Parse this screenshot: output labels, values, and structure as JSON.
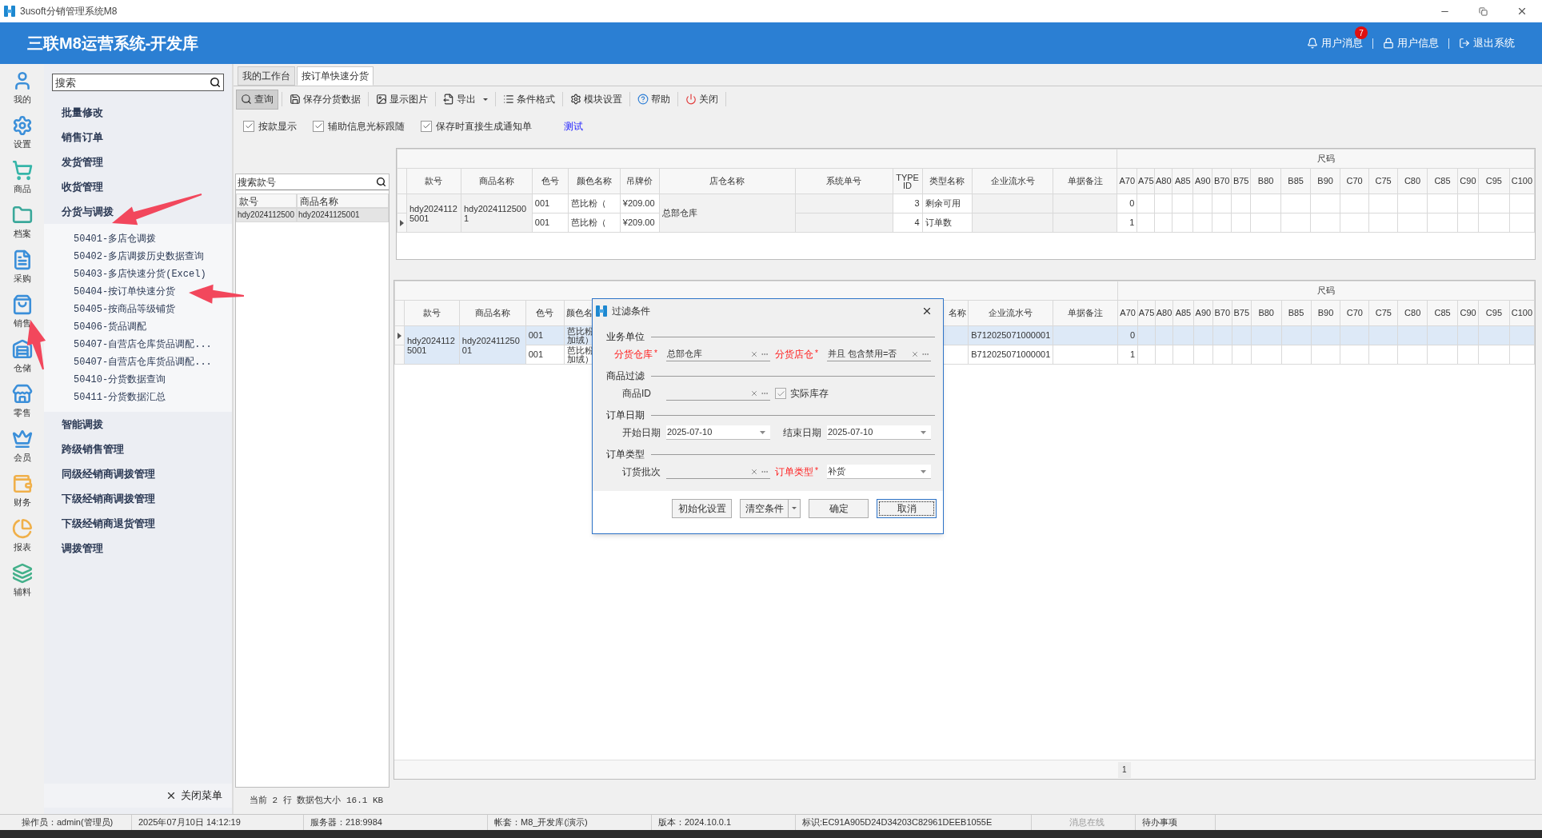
{
  "window": {
    "title": "3usoft分销管理系统M8"
  },
  "header": {
    "title": "三联M8运营系统-开发库",
    "actions": [
      {
        "kind": "messages",
        "label": "用户消息",
        "badge": "7"
      },
      {
        "kind": "user",
        "label": "用户信息"
      },
      {
        "kind": "logout",
        "label": "退出系统"
      }
    ]
  },
  "rail": [
    {
      "kind": "user",
      "label": "我的"
    },
    {
      "kind": "settings",
      "label": "设置"
    },
    {
      "kind": "cart",
      "label": "商品"
    },
    {
      "kind": "folder",
      "label": "档案"
    },
    {
      "kind": "doc",
      "label": "采购"
    },
    {
      "kind": "bag",
      "label": "销售"
    },
    {
      "kind": "warehouse",
      "label": "仓储"
    },
    {
      "kind": "store",
      "label": "零售"
    },
    {
      "kind": "crown",
      "label": "会员"
    },
    {
      "kind": "wallet",
      "label": "财务"
    },
    {
      "kind": "pie",
      "label": "报表"
    },
    {
      "kind": "layers",
      "label": "辅料"
    }
  ],
  "menu": {
    "search_placeholder": "搜索",
    "close_label": "关闭菜单",
    "groups": [
      {
        "label": "批量修改"
      },
      {
        "label": "销售订单"
      },
      {
        "label": "发货管理"
      },
      {
        "label": "收货管理"
      },
      {
        "label": "分货与调拨",
        "children": [
          {
            "label": "50401-多店仓调拨"
          },
          {
            "label": "50402-多店调拨历史数据查询"
          },
          {
            "label": "50403-多店快速分货(Excel)"
          },
          {
            "label": "50404-按订单快速分货"
          },
          {
            "label": "50405-按商品等级铺货"
          },
          {
            "label": "50406-货品调配"
          },
          {
            "label": "50407-自营店仓库货品调配..."
          },
          {
            "label": "50407-自营店仓库货品调配..."
          },
          {
            "label": "50410-分货数据查询"
          },
          {
            "label": "50411-分货数据汇总"
          }
        ]
      },
      {
        "label": "智能调拨"
      },
      {
        "label": "跨级销售管理"
      },
      {
        "label": "同级经销商调拨管理"
      },
      {
        "label": "下级经销商调拨管理"
      },
      {
        "label": "下级经销商退货管理"
      },
      {
        "label": "调拨管理"
      }
    ]
  },
  "tabs": [
    {
      "label": "我的工作台",
      "selected": false
    },
    {
      "label": "按订单快速分货",
      "selected": true
    }
  ],
  "toolbar": [
    {
      "kind": "search",
      "label": "查询",
      "pressed": true
    },
    {
      "kind": "save",
      "label": "保存分货数据",
      "pressed": false
    },
    {
      "kind": "image",
      "label": "显示图片",
      "pressed": false
    },
    {
      "kind": "export",
      "label": "导出",
      "pressed": false,
      "dropdown": true
    },
    {
      "kind": "list",
      "label": "条件格式",
      "pressed": false
    },
    {
      "kind": "settings",
      "label": "模块设置",
      "pressed": false
    },
    {
      "kind": "help",
      "label": "帮助",
      "pressed": false
    },
    {
      "kind": "power",
      "label": "关闭",
      "pressed": false
    }
  ],
  "options": [
    {
      "label": "按款显示",
      "checked": true
    },
    {
      "label": "辅助信息光标跟随",
      "checked": true
    },
    {
      "label": "保存时直接生成通知单",
      "checked": true
    }
  ],
  "link": "测试",
  "style_list": {
    "search_placeholder": "搜索款号",
    "columns": [
      "款号",
      "商品名称"
    ],
    "rows": [
      {
        "cells": [
          "hdy2024112500",
          "hdy20241125001"
        ],
        "selected": true
      }
    ]
  },
  "upper_grid": {
    "size_header": "尺码",
    "columns": [
      "款号",
      "商品名称",
      "色号",
      "颜色名称",
      "吊牌价",
      "店仓名称",
      "系统单号",
      "TYPE ID",
      "类型名称",
      "企业流水号",
      "单据备注"
    ],
    "size_columns": [
      "A70",
      "A75",
      "A80",
      "A85",
      "A90",
      "B70",
      "B75",
      "B80",
      "B85",
      "B90",
      "C70",
      "C75",
      "C80",
      "C85",
      "C90",
      "C95",
      "C100"
    ],
    "group": {
      "style_no": "hdy20241125001",
      "product_name": "hdy20241125001",
      "store": "总部仓库",
      "lines": [
        {
          "current": false,
          "color_code": "001",
          "color_name": "芭比粉（",
          "price": "¥209.00",
          "type_id": "3",
          "type_name": "剩余可用",
          "sizes": [
            "0"
          ]
        },
        {
          "current": true,
          "color_code": "001",
          "color_name": "芭比粉（",
          "price": "¥209.00",
          "type_id": "4",
          "type_name": "订单数",
          "sizes": [
            "1"
          ]
        }
      ]
    }
  },
  "lower_grid": {
    "size_header": "尺码",
    "columns_left": [
      "款号",
      "商品名称",
      "色号",
      "颜色名"
    ],
    "columns_right": [
      "名称",
      "企业流水号",
      "单据备注"
    ],
    "size_columns": [
      "A70",
      "A75",
      "A80",
      "A85",
      "A90",
      "B70",
      "B75",
      "B80",
      "B85",
      "B90",
      "C70",
      "C75",
      "C80",
      "C85",
      "C90",
      "C95",
      "C100"
    ],
    "group": {
      "style_no": "hdy20241125001",
      "product_name": "hdy20241125001",
      "lines": [
        {
          "current": true,
          "selected": true,
          "color_code": "001",
          "color_name": "芭比粉加绒）",
          "serial": "B712025071000001",
          "sizes": [
            "0"
          ]
        },
        {
          "current": false,
          "selected": false,
          "color_code": "001",
          "color_name": "芭比粉加绒）",
          "serial": "B712025071000001",
          "sizes": [
            "1"
          ]
        }
      ]
    }
  },
  "pager": {
    "pages": [
      "1"
    ]
  },
  "footer": "当前 2 行 数据包大小 16.1 KB",
  "dialog": {
    "title": "过滤条件",
    "sections": [
      {
        "title": "业务单位",
        "fields": [
          {
            "kind": "lookup",
            "label": "分货仓库",
            "required": true,
            "mark": "*",
            "value": "总部仓库"
          },
          {
            "kind": "lookup",
            "label": "分货店仓",
            "required": true,
            "mark": "*",
            "value": "并且 包含禁用=否"
          }
        ]
      },
      {
        "title": "商品过滤",
        "fields": [
          {
            "kind": "lookup",
            "label": "商品ID",
            "required": false
          },
          {
            "kind": "checkbox",
            "label": "实际库存",
            "checked": true
          }
        ]
      },
      {
        "title": "订单日期",
        "fields": [
          {
            "kind": "select",
            "label": "开始日期",
            "required": false,
            "value": "2025-07-10"
          },
          {
            "kind": "select",
            "label": "结束日期",
            "required": false,
            "value": "2025-07-10"
          }
        ]
      },
      {
        "title": "订单类型",
        "fields": [
          {
            "kind": "lookup",
            "label": "订货批次",
            "required": false
          },
          {
            "kind": "select",
            "label": "订单类型",
            "required": true,
            "mark": "*",
            "value": "补货"
          }
        ]
      }
    ],
    "buttons": [
      {
        "kind": "plain",
        "label": "初始化设置",
        "focused": false
      },
      {
        "kind": "split",
        "label": "清空条件",
        "focused": false
      },
      {
        "kind": "plain",
        "label": "确定",
        "focused": false
      },
      {
        "kind": "plain",
        "label": "取消",
        "focused": true
      }
    ]
  },
  "status_bar": [
    {
      "text": "操作员：admin(管理员)",
      "muted": false
    },
    {
      "text": "2025年07月10日 14:12:19",
      "muted": false
    },
    {
      "text": "服务器：218:9984",
      "muted": false
    },
    {
      "text": "帐套：M8_开发库(演示)",
      "muted": false
    },
    {
      "text": "版本：2024.10.0.1",
      "muted": false
    },
    {
      "text": "标识:EC91A905D24D34203C82961DEEB1055E",
      "muted": false
    },
    {
      "text": "消息在线",
      "muted": true
    },
    {
      "text": "待办事项",
      "muted": false
    }
  ]
}
